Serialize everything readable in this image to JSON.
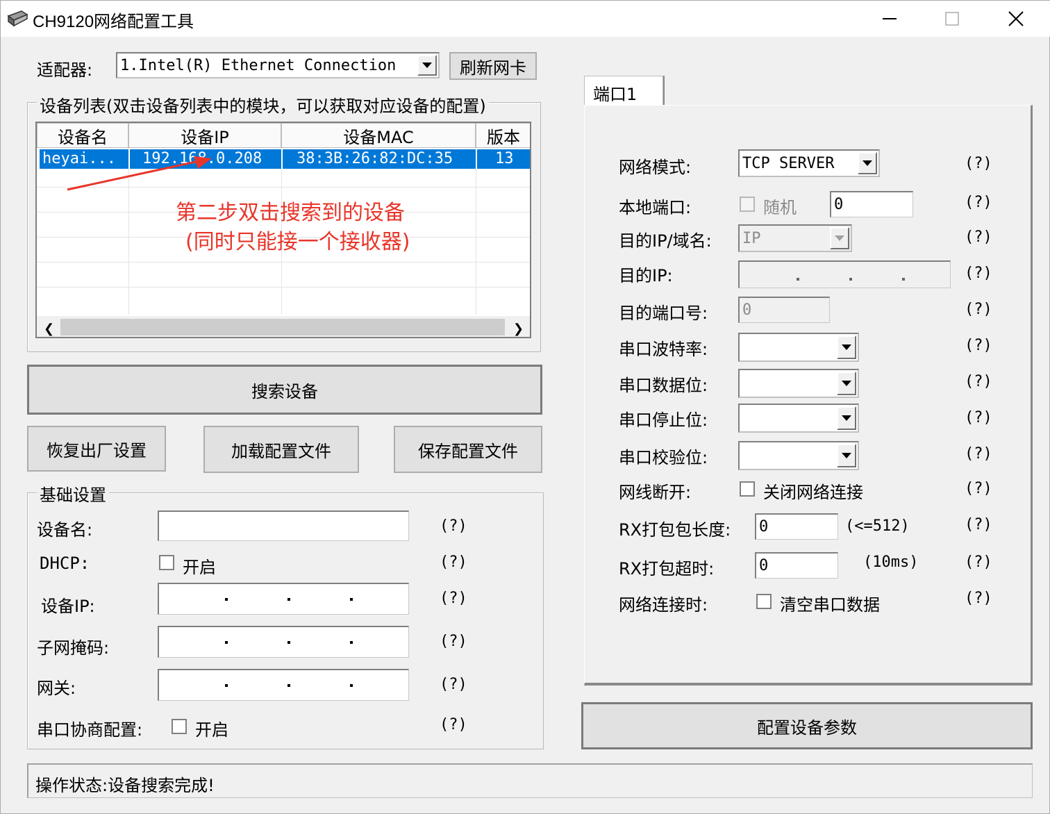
{
  "window": {
    "title": "CH9120网络配置工具"
  },
  "adapter": {
    "label": "适配器:",
    "selected": "1.Intel(R) Ethernet Connection",
    "refresh_button": "刷新网卡"
  },
  "device_list": {
    "group_title": "设备列表(双击设备列表中的模块，可以获取对应设备的配置)",
    "columns": [
      "设备名",
      "设备IP",
      "设备MAC",
      "版本"
    ],
    "rows": [
      {
        "name": "heyai...",
        "ip": "192.168.0.208",
        "mac": "38:3B:26:82:DC:35",
        "version": "13"
      }
    ],
    "annotation_line1": "第二步双击搜索到的设备",
    "annotation_line2": "(同时只能接一个接收器)"
  },
  "buttons": {
    "search": "搜索设备",
    "restore": "恢复出厂设置",
    "load": "加载配置文件",
    "save": "保存配置文件",
    "configure": "配置设备参数"
  },
  "basic": {
    "group_title": "基础设置",
    "device_name_label": "设备名:",
    "dhcp_label": "DHCP:",
    "dhcp_check": "开启",
    "device_ip_label": "设备IP:",
    "subnet_label": "子网掩码:",
    "gateway_label": "网关:",
    "serial_neg_label": "串口协商配置:",
    "serial_neg_check": "开启",
    "help": "(?)"
  },
  "port": {
    "tab": "端口1",
    "net_mode_label": "网络模式:",
    "net_mode_value": "TCP SERVER",
    "local_port_label": "本地端口:",
    "random_check": "随机",
    "local_port_value": "0",
    "dest_ip_domain_label": "目的IP/域名:",
    "dest_ip_domain_value": "IP",
    "dest_ip_label": "目的IP:",
    "dest_port_label": "目的端口号:",
    "dest_port_value": "0",
    "baud_label": "串口波特率:",
    "data_bits_label": "串口数据位:",
    "stop_bits_label": "串口停止位:",
    "parity_label": "串口校验位:",
    "disconnect_label": "网线断开:",
    "disconnect_check": "关闭网络连接",
    "rx_len_label": "RX打包包长度:",
    "rx_len_value": "0",
    "rx_len_hint": "(<=512)",
    "rx_timeout_label": "RX打包超时:",
    "rx_timeout_value": "0",
    "rx_timeout_hint": "(10ms)",
    "on_connect_label": "网络连接时:",
    "on_connect_check": "清空串口数据",
    "help": "(?)"
  },
  "status": {
    "text": "操作状态:设备搜索完成!"
  },
  "colors": {
    "selection": "#0078d7",
    "annotation": "#e8352a"
  }
}
